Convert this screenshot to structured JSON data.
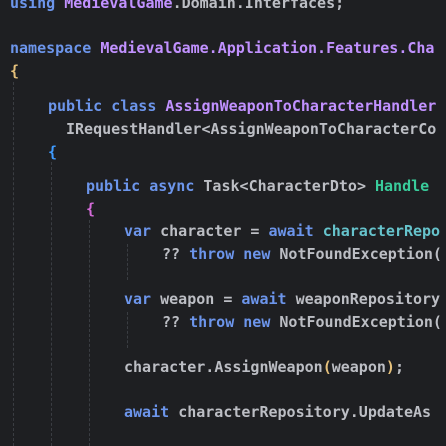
{
  "code": {
    "l1_kw": "using",
    "l1_ns": "MedievalGame",
    "l1_rest": ".Domain.Interfaces;",
    "l2_kw": "namespace",
    "l2_ns": "MedievalGame.Application.Features.Cha",
    "l3_brace": "{",
    "l4_kw1": "public",
    "l4_kw2": "class",
    "l4_cls": "AssignWeaponToCharacterHandler",
    "l5_iface": "IRequestHandler",
    "l5_lt": "<",
    "l5_gen": "AssignWeaponToCharacterCo",
    "l6_brace": "{",
    "l7_kw1": "public",
    "l7_kw2": "async",
    "l7_type": "Task",
    "l7_lt": "<",
    "l7_dto": "CharacterDto",
    "l7_gt": ">",
    "l7_fn": "Handle",
    "l8_brace": "{",
    "l9_kw": "var",
    "l9_var": "character",
    "l9_eq": " = ",
    "l9_await": "await",
    "l9_ref": "characterRepo",
    "l10_op": "??",
    "l10_throw": "throw",
    "l10_new": "new",
    "l10_ex": "NotFoundException(",
    "l11_kw": "var",
    "l11_var": "weapon",
    "l11_eq": " = ",
    "l11_await": "await",
    "l11_ref": "weaponRepository",
    "l12_op": "??",
    "l12_throw": "throw",
    "l12_new": "new",
    "l12_ex": "NotFoundException(",
    "l13_obj": "character.",
    "l13_fn": "AssignWeapon",
    "l13_open": "(",
    "l13_arg": "weapon",
    "l13_close": ")",
    "l13_semi": ";",
    "l14_await": "await",
    "l14_ref": "characterRepository.UpdateAs"
  }
}
